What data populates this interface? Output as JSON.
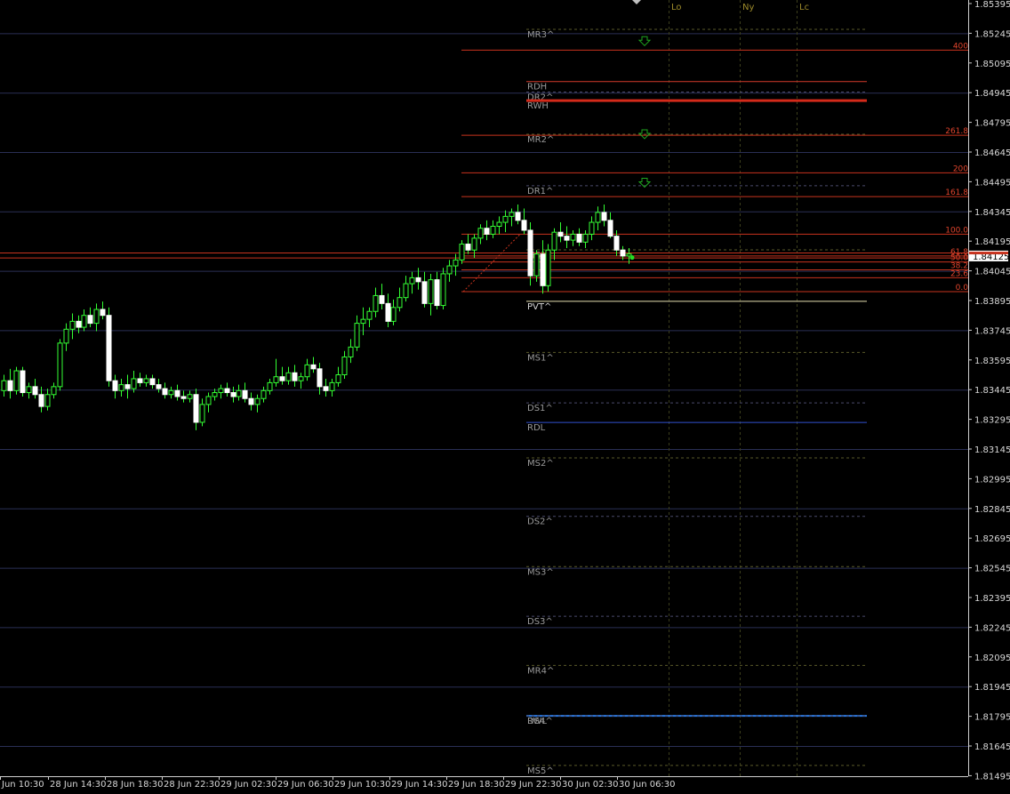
{
  "chart_data": {
    "type": "candlestick",
    "symbol_price": "1.84125",
    "ylim": [
      1.815,
      1.8545
    ],
    "y_ticks": [
      "1.85395",
      "1.85245",
      "1.85095",
      "1.84945",
      "1.84795",
      "1.84645",
      "1.84495",
      "1.84345",
      "1.84195",
      "1.84045",
      "1.83895",
      "1.83745",
      "1.83595",
      "1.83445",
      "1.83295",
      "1.83145",
      "1.82995",
      "1.82845",
      "1.82695",
      "1.82545",
      "1.82395",
      "1.82245",
      "1.82095",
      "1.81945",
      "1.81795",
      "1.81645",
      "1.81495"
    ],
    "x_ticks": [
      "Jun 10:30",
      "28 Jun 14:30",
      "28 Jun 18:30",
      "28 Jun 22:30",
      "29 Jun 02:30",
      "29 Jun 06:30",
      "29 Jun 10:30",
      "29 Jun 14:30",
      "29 Jun 18:30",
      "29 Jun 22:30",
      "30 Jun 02:30",
      "30 Jun 06:30"
    ],
    "session_markers": [
      "Lo",
      "Ny",
      "Lc"
    ],
    "pivot_levels": [
      {
        "label": "MR3^",
        "price": 1.85265
      },
      {
        "label": "RDH",
        "price": 1.85001
      },
      {
        "label": "DR2^",
        "price": 1.84948
      },
      {
        "label": "RWH",
        "price": 1.84905
      },
      {
        "label": "MR2^",
        "price": 1.84735
      },
      {
        "label": "DR1^",
        "price": 1.84475
      },
      {
        "label": "MS1^",
        "price": 1.84151
      },
      {
        "label": "PVT^",
        "price": 1.83891
      },
      {
        "label": "MS1^",
        "price": 1.83633
      },
      {
        "label": "DS1^",
        "price": 1.83378
      },
      {
        "label": "RDL",
        "price": 1.83279
      },
      {
        "label": "MS2^",
        "price": 1.831
      },
      {
        "label": "DS2^",
        "price": 1.82805
      },
      {
        "label": "MS3^",
        "price": 1.82551
      },
      {
        "label": "DS3^",
        "price": 1.823
      },
      {
        "label": "MR4^",
        "price": 1.82052
      },
      {
        "label": "RWL",
        "price": 1.81797
      },
      {
        "label": "DS4^",
        "price": 1.81797
      },
      {
        "label": "MS5^",
        "price": 1.81547
      }
    ],
    "fib_levels": [
      {
        "label": "400",
        "price": 1.8516
      },
      {
        "label": "261.8",
        "price": 1.8473
      },
      {
        "label": "200",
        "price": 1.8454
      },
      {
        "label": "161.8",
        "price": 1.8442
      },
      {
        "label": "100.0",
        "price": 1.8423
      },
      {
        "label": "61.8",
        "price": 1.8412
      },
      {
        "label": "50.0",
        "price": 1.8409
      },
      {
        "label": "38.2",
        "price": 1.8405
      },
      {
        "label": "23.6",
        "price": 1.8401
      },
      {
        "label": "0.0",
        "price": 1.8394
      }
    ],
    "candles": [
      [
        1.8344,
        1.8352,
        1.8341,
        1.8349
      ],
      [
        1.8349,
        1.8355,
        1.834,
        1.8344
      ],
      [
        1.8344,
        1.8356,
        1.8342,
        1.8354
      ],
      [
        1.8354,
        1.8356,
        1.8341,
        1.8343
      ],
      [
        1.8343,
        1.8348,
        1.834,
        1.8346
      ],
      [
        1.8346,
        1.835,
        1.834,
        1.8342
      ],
      [
        1.8342,
        1.8346,
        1.8333,
        1.8336
      ],
      [
        1.8336,
        1.8345,
        1.8334,
        1.8342
      ],
      [
        1.8342,
        1.8348,
        1.834,
        1.8346
      ],
      [
        1.8346,
        1.837,
        1.8344,
        1.8368
      ],
      [
        1.8368,
        1.8378,
        1.8364,
        1.8375
      ],
      [
        1.8375,
        1.8383,
        1.837,
        1.8379
      ],
      [
        1.8379,
        1.8382,
        1.8373,
        1.8376
      ],
      [
        1.8376,
        1.8385,
        1.8374,
        1.8382
      ],
      [
        1.8382,
        1.8386,
        1.8376,
        1.8378
      ],
      [
        1.8378,
        1.8388,
        1.8374,
        1.8385
      ],
      [
        1.8385,
        1.8389,
        1.838,
        1.8382
      ],
      [
        1.8382,
        1.8386,
        1.8346,
        1.8349
      ],
      [
        1.8349,
        1.8352,
        1.834,
        1.8344
      ],
      [
        1.8344,
        1.835,
        1.8341,
        1.8347
      ],
      [
        1.8347,
        1.8352,
        1.834,
        1.8345
      ],
      [
        1.8345,
        1.8354,
        1.8343,
        1.835
      ],
      [
        1.835,
        1.8353,
        1.8346,
        1.8348
      ],
      [
        1.8348,
        1.8352,
        1.8346,
        1.835
      ],
      [
        1.835,
        1.8352,
        1.8345,
        1.8347
      ],
      [
        1.8347,
        1.835,
        1.8343,
        1.8345
      ],
      [
        1.8345,
        1.8348,
        1.834,
        1.8342
      ],
      [
        1.8342,
        1.8346,
        1.834,
        1.8344
      ],
      [
        1.8344,
        1.8347,
        1.8339,
        1.8341
      ],
      [
        1.8341,
        1.8344,
        1.8338,
        1.834
      ],
      [
        1.834,
        1.8344,
        1.8338,
        1.8342
      ],
      [
        1.8342,
        1.8345,
        1.8324,
        1.8328
      ],
      [
        1.8328,
        1.834,
        1.8326,
        1.8337
      ],
      [
        1.8337,
        1.8343,
        1.8333,
        1.8341
      ],
      [
        1.8341,
        1.8345,
        1.8339,
        1.8343
      ],
      [
        1.8343,
        1.8347,
        1.834,
        1.8345
      ],
      [
        1.8345,
        1.8348,
        1.8341,
        1.8343
      ],
      [
        1.8343,
        1.8346,
        1.8338,
        1.8341
      ],
      [
        1.8341,
        1.8347,
        1.8339,
        1.8344
      ],
      [
        1.8344,
        1.8348,
        1.8338,
        1.834
      ],
      [
        1.834,
        1.8343,
        1.8334,
        1.8337
      ],
      [
        1.8337,
        1.8342,
        1.8333,
        1.834
      ],
      [
        1.834,
        1.8346,
        1.8338,
        1.8344
      ],
      [
        1.8344,
        1.835,
        1.8342,
        1.8348
      ],
      [
        1.8348,
        1.836,
        1.8346,
        1.8351
      ],
      [
        1.8351,
        1.8356,
        1.8347,
        1.8349
      ],
      [
        1.8349,
        1.8356,
        1.8347,
        1.8353
      ],
      [
        1.8353,
        1.8357,
        1.8346,
        1.8349
      ],
      [
        1.8349,
        1.8353,
        1.8345,
        1.8351
      ],
      [
        1.8351,
        1.836,
        1.8349,
        1.8357
      ],
      [
        1.8357,
        1.8361,
        1.8353,
        1.8355
      ],
      [
        1.8355,
        1.8358,
        1.8342,
        1.8346
      ],
      [
        1.8346,
        1.835,
        1.8341,
        1.8344
      ],
      [
        1.8344,
        1.835,
        1.8341,
        1.8348
      ],
      [
        1.8348,
        1.8356,
        1.8346,
        1.8352
      ],
      [
        1.8352,
        1.8364,
        1.835,
        1.8361
      ],
      [
        1.8361,
        1.837,
        1.8358,
        1.8366
      ],
      [
        1.8366,
        1.8382,
        1.8364,
        1.8378
      ],
      [
        1.8378,
        1.8386,
        1.8372,
        1.838
      ],
      [
        1.838,
        1.8386,
        1.8376,
        1.8384
      ],
      [
        1.8384,
        1.8396,
        1.8381,
        1.8392
      ],
      [
        1.8392,
        1.8398,
        1.8385,
        1.8388
      ],
      [
        1.8388,
        1.8393,
        1.8376,
        1.8379
      ],
      [
        1.8379,
        1.839,
        1.8377,
        1.8386
      ],
      [
        1.8386,
        1.8396,
        1.8384,
        1.8391
      ],
      [
        1.8391,
        1.8402,
        1.8389,
        1.8398
      ],
      [
        1.8398,
        1.8404,
        1.8393,
        1.8401
      ],
      [
        1.8401,
        1.8406,
        1.8395,
        1.8399
      ],
      [
        1.8399,
        1.8404,
        1.8386,
        1.8388
      ],
      [
        1.8388,
        1.8403,
        1.8382,
        1.84
      ],
      [
        1.84,
        1.8404,
        1.8385,
        1.8387
      ],
      [
        1.8387,
        1.8406,
        1.8385,
        1.8403
      ],
      [
        1.8403,
        1.841,
        1.8399,
        1.8407
      ],
      [
        1.8407,
        1.8413,
        1.8402,
        1.841
      ],
      [
        1.841,
        1.842,
        1.8408,
        1.8418
      ],
      [
        1.8418,
        1.8423,
        1.8413,
        1.8415
      ],
      [
        1.8415,
        1.8423,
        1.8411,
        1.8421
      ],
      [
        1.8421,
        1.8428,
        1.8418,
        1.8426
      ],
      [
        1.8426,
        1.843,
        1.842,
        1.8423
      ],
      [
        1.8423,
        1.843,
        1.8421,
        1.8427
      ],
      [
        1.8427,
        1.8432,
        1.8423,
        1.8429
      ],
      [
        1.8429,
        1.8435,
        1.8424,
        1.8432
      ],
      [
        1.8432,
        1.8436,
        1.8427,
        1.8434
      ],
      [
        1.8434,
        1.8438,
        1.8428,
        1.843
      ],
      [
        1.843,
        1.8436,
        1.8423,
        1.8425
      ],
      [
        1.8425,
        1.8429,
        1.8397,
        1.8402
      ],
      [
        1.8402,
        1.8415,
        1.8399,
        1.8413
      ],
      [
        1.8413,
        1.842,
        1.8393,
        1.8397
      ],
      [
        1.8397,
        1.8418,
        1.8394,
        1.8415
      ],
      [
        1.8415,
        1.8426,
        1.841,
        1.8424
      ],
      [
        1.8424,
        1.8429,
        1.8419,
        1.8422
      ],
      [
        1.8422,
        1.8427,
        1.8416,
        1.842
      ],
      [
        1.842,
        1.8425,
        1.8417,
        1.8423
      ],
      [
        1.8423,
        1.8426,
        1.8417,
        1.8419
      ],
      [
        1.8419,
        1.8425,
        1.8416,
        1.8423
      ],
      [
        1.8423,
        1.8432,
        1.842,
        1.8429
      ],
      [
        1.8429,
        1.8437,
        1.8425,
        1.8434
      ],
      [
        1.8434,
        1.8438,
        1.8427,
        1.843
      ],
      [
        1.843,
        1.8434,
        1.8421,
        1.8422
      ],
      [
        1.8422,
        1.8425,
        1.8412,
        1.8415
      ],
      [
        1.8415,
        1.8417,
        1.841,
        1.8412
      ],
      [
        1.8412,
        1.8416,
        1.8408,
        1.8413
      ]
    ]
  }
}
